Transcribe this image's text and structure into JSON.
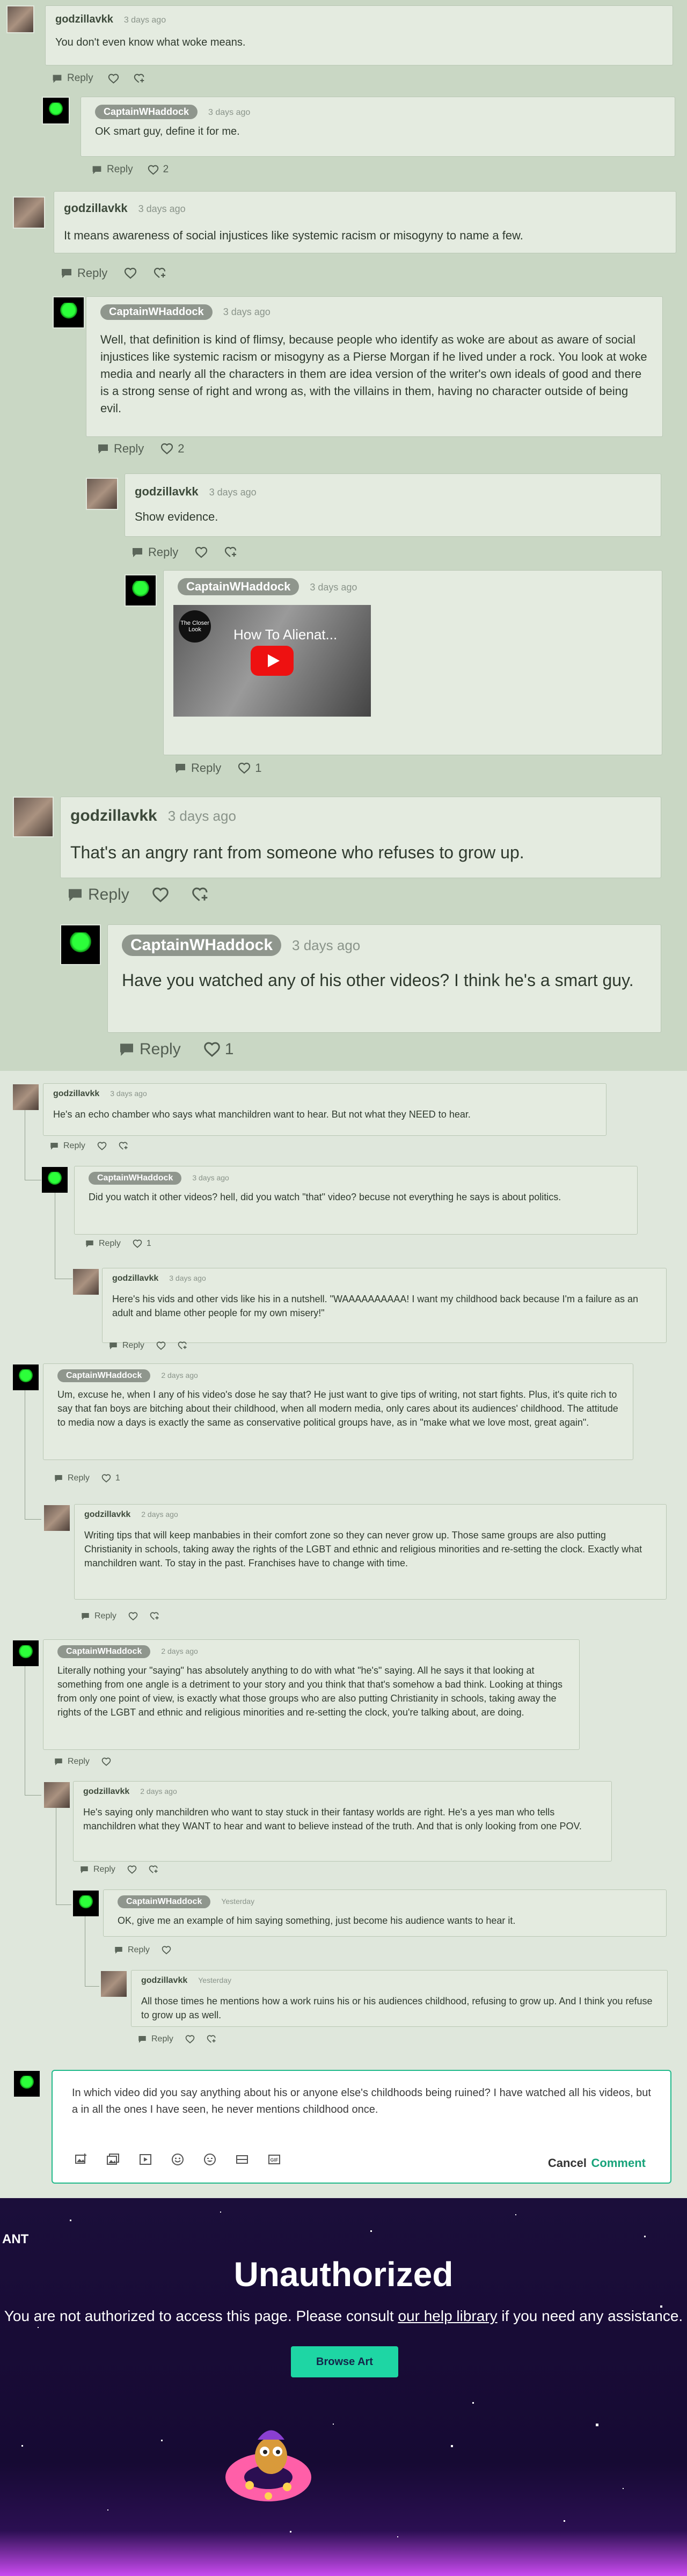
{
  "comments": [
    {
      "user": "godzillavkk",
      "date": "3 days ago",
      "text": "You don't even know what woke means.",
      "reply": "Reply",
      "likes": ""
    },
    {
      "user": "CaptainWHaddock",
      "date": "3 days ago",
      "text": "OK smart guy, define it for me.",
      "reply": "Reply",
      "likes": "2"
    },
    {
      "user": "godzillavkk",
      "date": "3 days ago",
      "text": "It means awareness of social injustices like systemic racism or misogyny to name a few.",
      "reply": "Reply",
      "likes": ""
    },
    {
      "user": "CaptainWHaddock",
      "date": "3 days ago",
      "text": "Well, that definition is kind of flimsy, because people who identify as woke are about as aware of social injustices like systemic racism or misogyny as a Pierse Morgan if he lived under a rock. You look at woke media and nearly all the characters in them are idea version of the writer's own ideals of good and there is a strong sense of right and wrong as, with the villains in them, having no character outside of being evil.",
      "reply": "Reply",
      "likes": "2"
    },
    {
      "user": "godzillavkk",
      "date": "3 days ago",
      "text": "Show evidence.",
      "reply": "Reply",
      "likes": ""
    },
    {
      "user": "CaptainWHaddock",
      "date": "3 days ago",
      "text": "",
      "reply": "Reply",
      "likes": "1",
      "video": {
        "title": "How To Alienat...",
        "channel": "The Closer Look"
      }
    },
    {
      "user": "godzillavkk",
      "date": "3 days ago",
      "text": "That's an angry rant from someone who refuses to grow up.",
      "reply": "Reply",
      "likes": ""
    },
    {
      "user": "CaptainWHaddock",
      "date": "3 days ago",
      "text": "Have you watched any of his other videos? I think he's a smart guy.",
      "reply": "Reply",
      "likes": "1"
    },
    {
      "user": "godzillavkk",
      "date": "3 days ago",
      "text": "He's an echo chamber who says what manchildren want to hear. But not what they NEED to hear.",
      "reply": "Reply",
      "likes": ""
    },
    {
      "user": "CaptainWHaddock",
      "date": "3 days ago",
      "text": "Did you watch it other videos? hell, did you watch \"that\" video? becuse not everything he says is about politics.",
      "reply": "Reply",
      "likes": "1"
    },
    {
      "user": "godzillavkk",
      "date": "3 days ago",
      "text": "Here's his vids and other vids like his in a nutshell. \"WAAAAAAAAAA! I want my childhood back because I'm a failure as an adult and blame other people for my own misery!\"",
      "reply": "Reply",
      "likes": ""
    },
    {
      "user": "CaptainWHaddock",
      "date": "2 days ago",
      "text": "Um, excuse he, when I any of his video's dose he say that? He just want to give tips of writing, not start fights. Plus, it's quite rich to say that fan boys are bitching about their childhood, when all modern media, only cares about its audiences' childhood. The attitude to media now a days is exactly the same as conservative political groups have, as in \"make what we love most, great again\".",
      "reply": "Reply",
      "likes": "1"
    },
    {
      "user": "godzillavkk",
      "date": "2 days ago",
      "text": "Writing tips that will keep manbabies in their comfort zone so they can never grow up. Those same groups are also putting Christianity in schools, taking away the rights of the LGBT and ethnic and religious minorities and re-setting the clock. Exactly what manchildren want. To stay in the past. Franchises have to change with time.",
      "reply": "Reply",
      "likes": ""
    },
    {
      "user": "CaptainWHaddock",
      "date": "2 days ago",
      "text": "Literally nothing your \"saying\" has absolutely anything to do with what \"he's\" saying. All he says it that looking at something from one angle is a detriment to your story and you think that that's somehow a bad think. Looking at things from only one point of view, is exactly what those groups who are also putting Christianity in schools, taking away the rights of the LGBT and ethnic and religious minorities and re-setting the clock, you're talking about, are doing.",
      "reply": "Reply",
      "likes": ""
    },
    {
      "user": "godzillavkk",
      "date": "2 days ago",
      "text": "He's saying only manchildren who want to stay stuck in their fantasy worlds are right. He's a yes man who tells manchildren what they WANT to hear and want to believe instead of the truth. And that is only looking from one POV.",
      "reply": "Reply",
      "likes": ""
    },
    {
      "user": "CaptainWHaddock",
      "date": "Yesterday",
      "text": "OK, give me an example of him saying something, just become his audience wants to hear it.",
      "reply": "Reply",
      "likes": ""
    },
    {
      "user": "godzillavkk",
      "date": "Yesterday",
      "text": "All those times he mentions how a work ruins his or his audiences childhood, refusing to grow up. And I think you refuse to grow up as well.",
      "reply": "Reply",
      "likes": ""
    }
  ],
  "editor": {
    "value": "In which video did you say anything about his or anyone else's childhoods being ruined? I have watched all his videos, but a in all the ones I have seen, he never mentions childhood once.",
    "cancel": "Cancel",
    "submit": "Comment"
  },
  "unauthorized": {
    "brand_fragment": "ANT",
    "title": "Unauthorized",
    "msg_before": "You are not authorized to access this page. Please consult ",
    "link": "our help library",
    "msg_after": " if you need any assistance.",
    "button": "Browse Art"
  },
  "colors": {
    "accent": "#1fb98a",
    "pill": "#8f968d",
    "button": "#1ed6a4"
  }
}
